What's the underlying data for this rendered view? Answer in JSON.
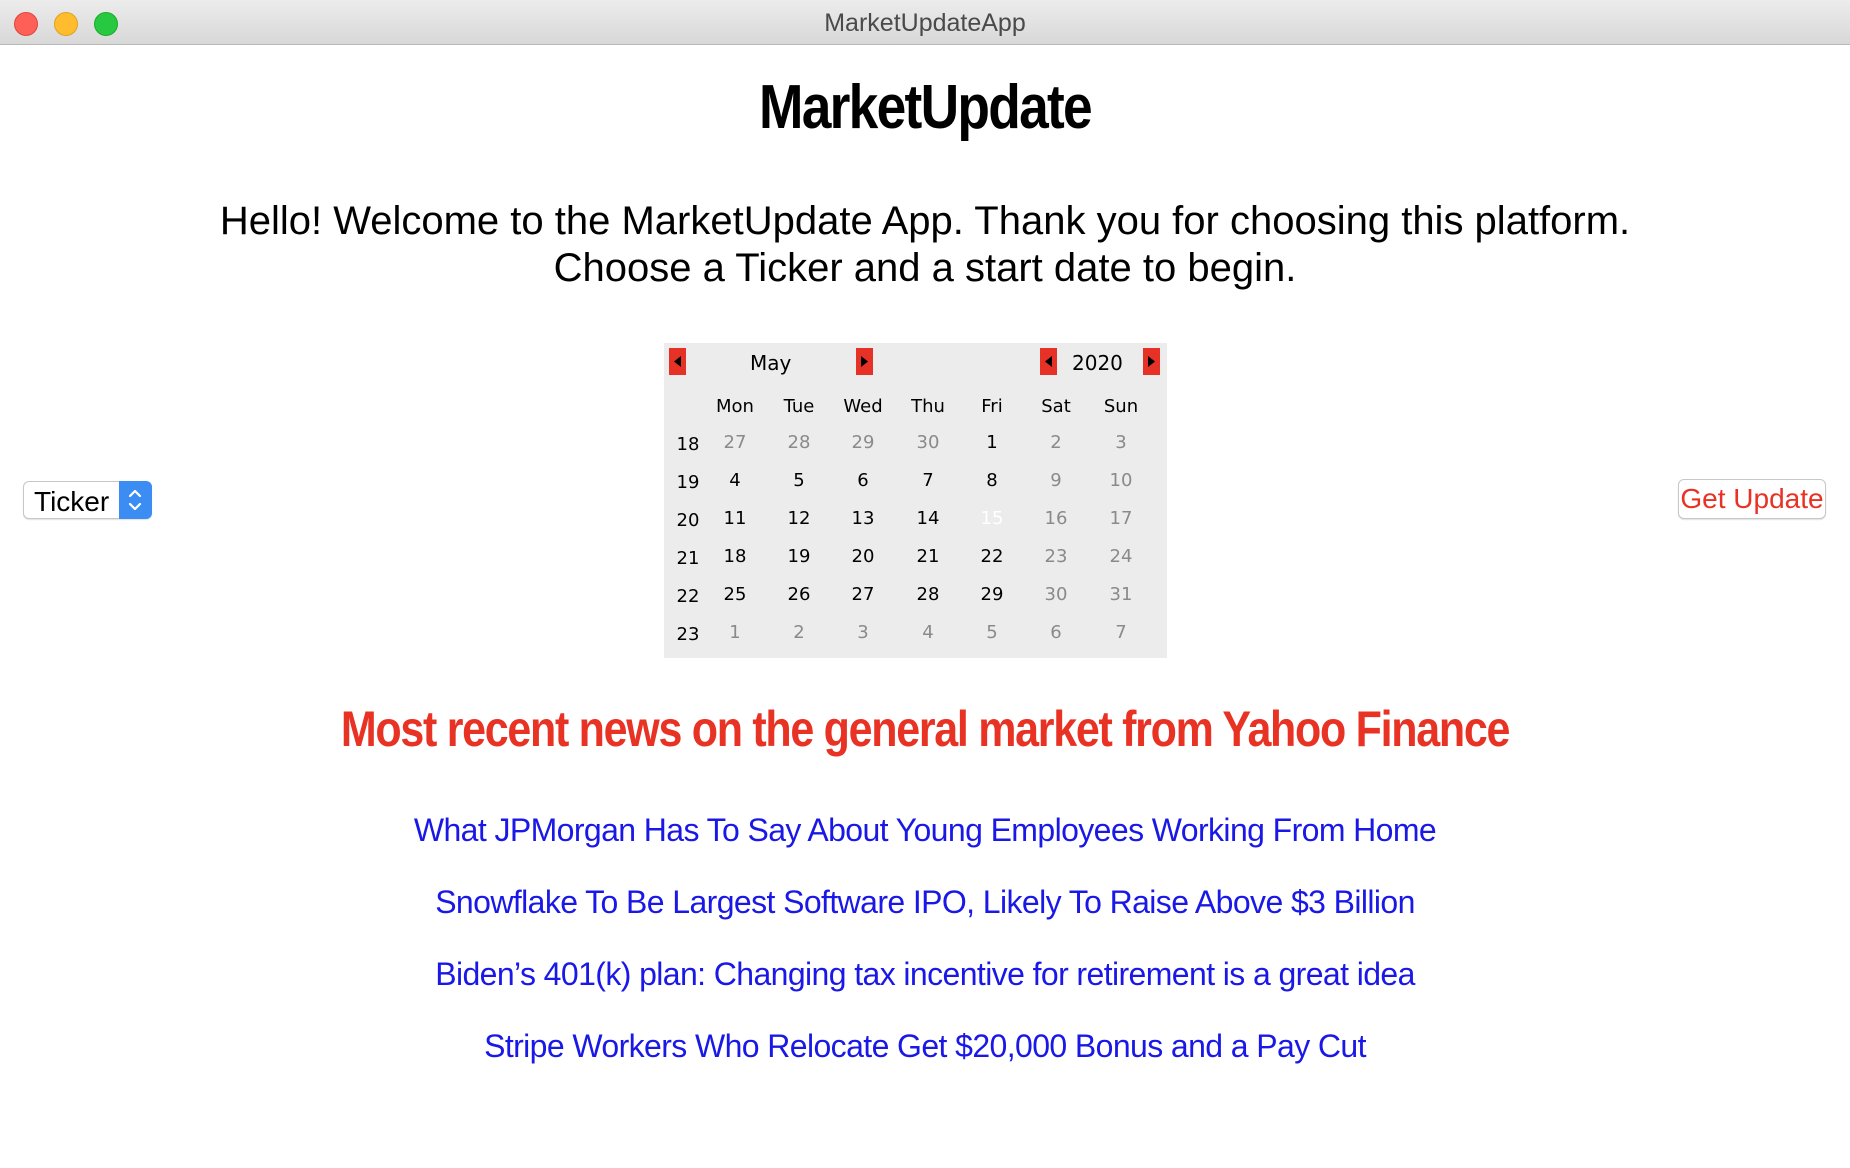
{
  "window": {
    "title": "MarketUpdateApp"
  },
  "app": {
    "heading": "MarketUpdate",
    "welcome_line1": "Hello! Welcome to the MarketUpdate App. Thank you for choosing this platform.",
    "welcome_line2": "Choose a Ticker and a start date to begin."
  },
  "ticker": {
    "label": "Ticker"
  },
  "get_update": {
    "label": "Get Update"
  },
  "calendar": {
    "month": "May",
    "year": "2020",
    "weekday_headers": [
      "Mon",
      "Tue",
      "Wed",
      "Thu",
      "Fri",
      "Sat",
      "Sun"
    ],
    "weeks": [
      {
        "week": "18",
        "days": [
          "27",
          "28",
          "29",
          "30",
          "1",
          "2",
          "3"
        ],
        "states": [
          "other",
          "other",
          "other",
          "other",
          "cur",
          "weekend",
          "weekend"
        ]
      },
      {
        "week": "19",
        "days": [
          "4",
          "5",
          "6",
          "7",
          "8",
          "9",
          "10"
        ],
        "states": [
          "cur",
          "cur",
          "cur",
          "cur",
          "cur",
          "weekend",
          "weekend"
        ]
      },
      {
        "week": "20",
        "days": [
          "11",
          "12",
          "13",
          "14",
          "15",
          "16",
          "17"
        ],
        "states": [
          "cur",
          "cur",
          "cur",
          "cur",
          "selected",
          "weekend",
          "weekend"
        ]
      },
      {
        "week": "21",
        "days": [
          "18",
          "19",
          "20",
          "21",
          "22",
          "23",
          "24"
        ],
        "states": [
          "cur",
          "cur",
          "cur",
          "cur",
          "cur",
          "weekend",
          "weekend"
        ]
      },
      {
        "week": "22",
        "days": [
          "25",
          "26",
          "27",
          "28",
          "29",
          "30",
          "31"
        ],
        "states": [
          "cur",
          "cur",
          "cur",
          "cur",
          "cur",
          "weekend",
          "weekend"
        ]
      },
      {
        "week": "23",
        "days": [
          "1",
          "2",
          "3",
          "4",
          "5",
          "6",
          "7"
        ],
        "states": [
          "other",
          "other",
          "other",
          "other",
          "other",
          "other",
          "other"
        ]
      }
    ],
    "selected_day": "15"
  },
  "news": {
    "heading": "Most recent news on the general market from Yahoo Finance",
    "items": [
      "What JPMorgan Has To Say About Young Employees Working From Home",
      "Snowflake To Be Largest Software IPO, Likely To Raise Above $3 Billion",
      "Biden’s 401(k) plan: Changing tax incentive for retirement is a great idea",
      "Stripe Workers Who Relocate Get $20,000 Bonus and a Pay Cut"
    ]
  },
  "colors": {
    "accent_red": "#e83224",
    "link_blue": "#1a18e6",
    "select_blue": "#3b8cf3"
  }
}
